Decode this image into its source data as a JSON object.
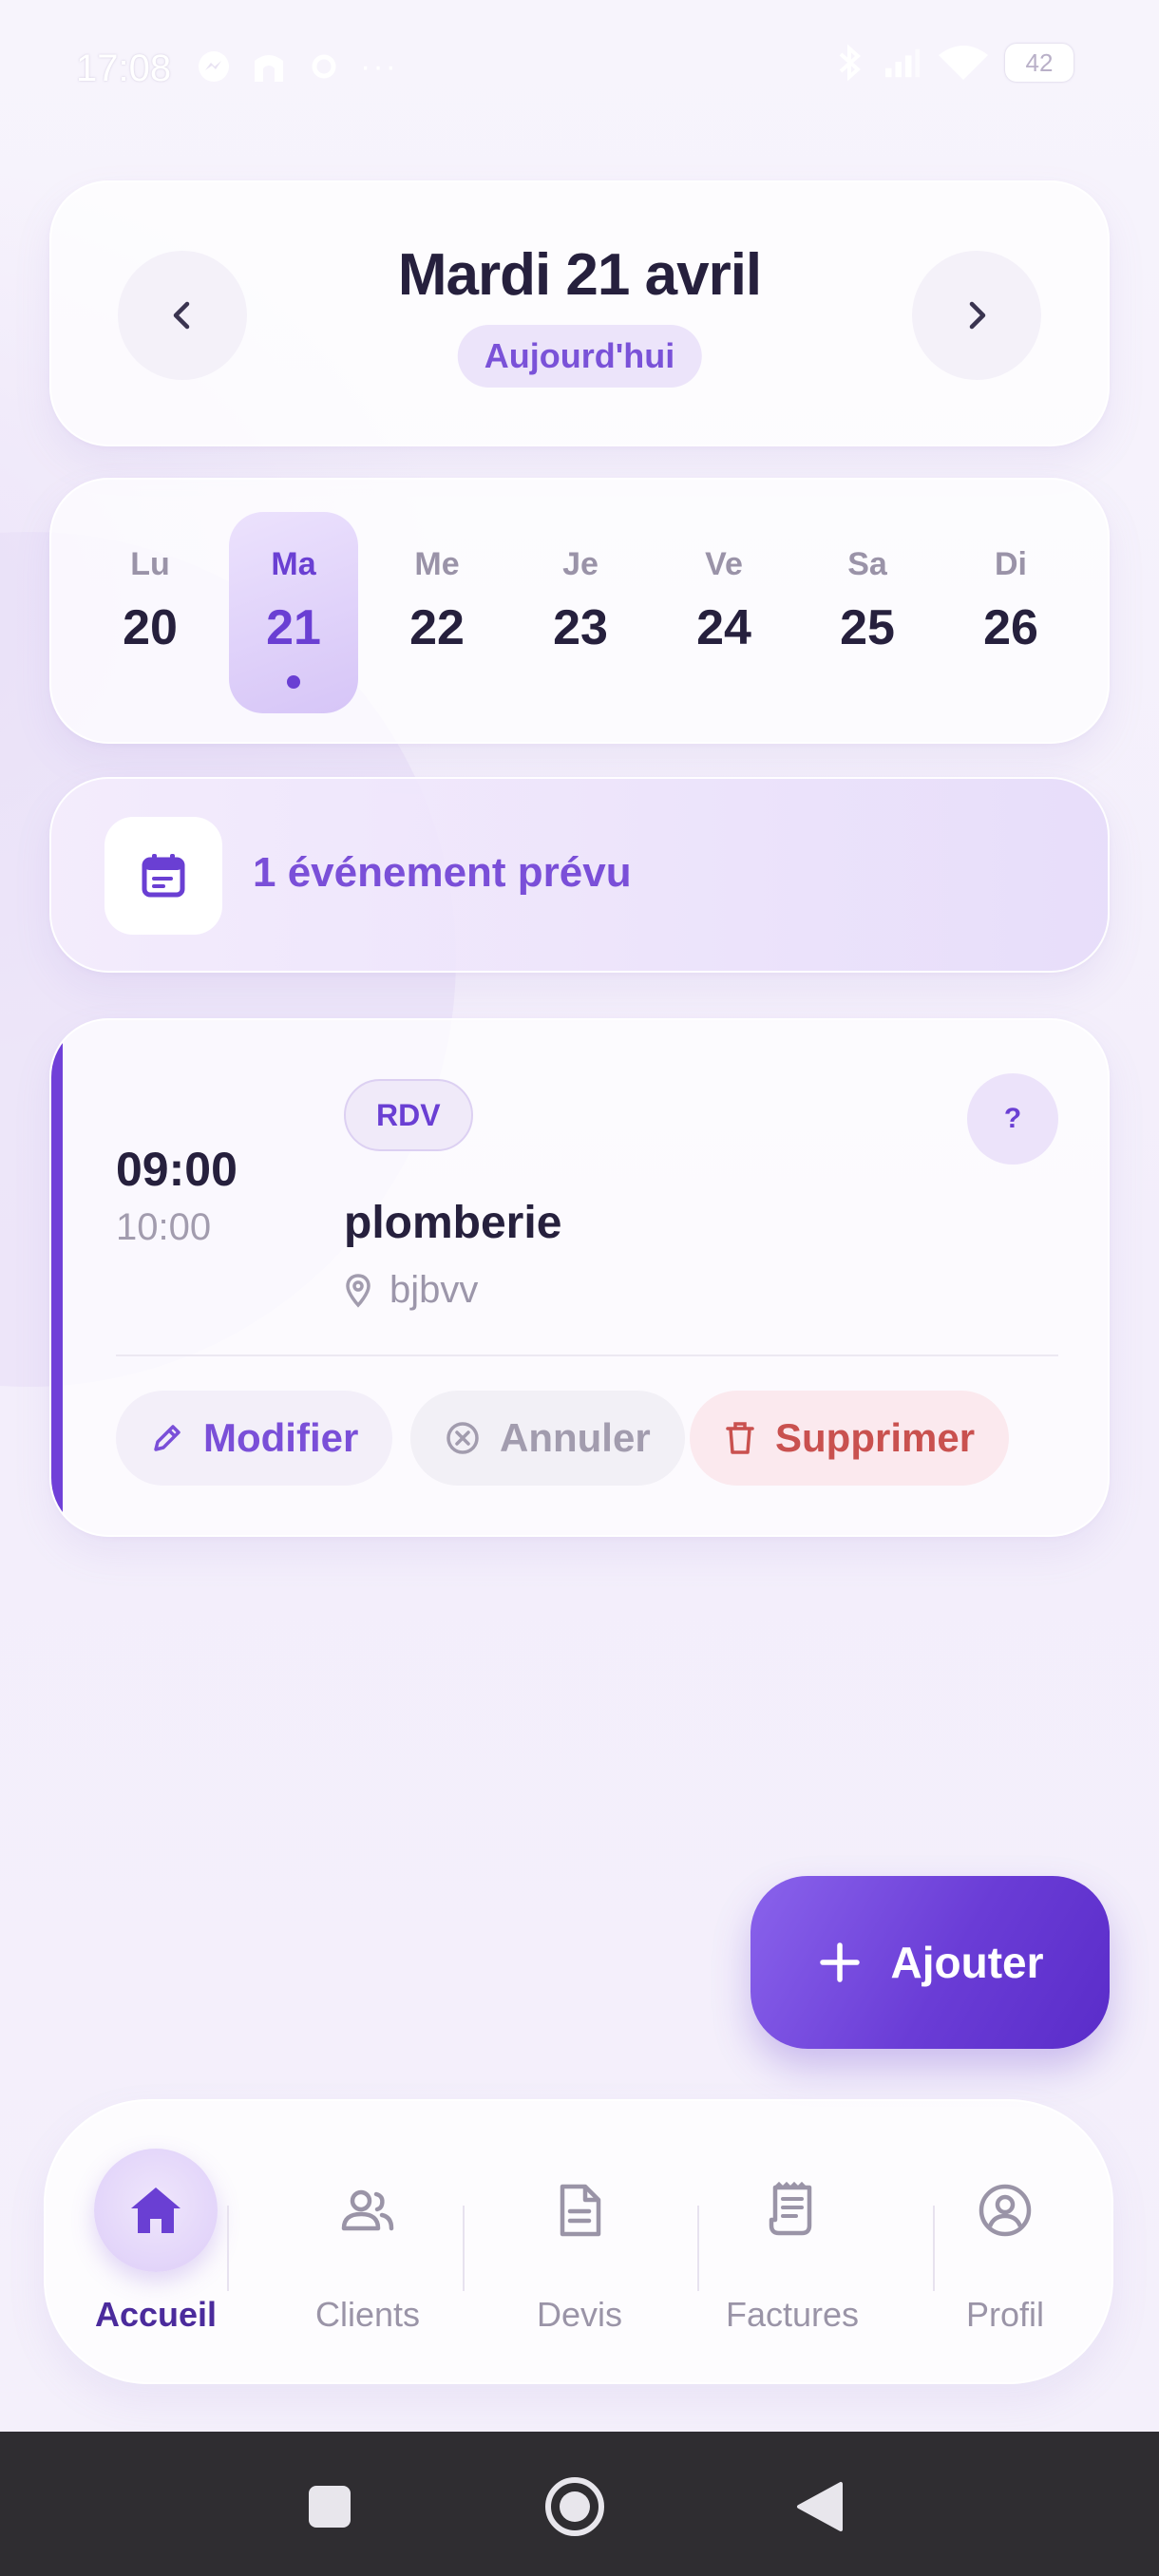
{
  "status_bar": {
    "time": "17:08",
    "notification_icons": [
      "messenger-icon",
      "home-app-icon",
      "settings-icon"
    ],
    "more_dots": "···",
    "system_icons": [
      "bluetooth-icon",
      "signal-icon",
      "wifi-icon"
    ],
    "battery": "42"
  },
  "header": {
    "date_title": "Mardi 21 avril",
    "today_label": "Aujourd'hui"
  },
  "week": {
    "days": [
      {
        "name": "Lu",
        "date": "20",
        "selected": false
      },
      {
        "name": "Ma",
        "date": "21",
        "selected": true,
        "has_event": true
      },
      {
        "name": "Me",
        "date": "22",
        "selected": false
      },
      {
        "name": "Je",
        "date": "23",
        "selected": false
      },
      {
        "name": "Ve",
        "date": "24",
        "selected": false
      },
      {
        "name": "Sa",
        "date": "25",
        "selected": false
      },
      {
        "name": "Di",
        "date": "26",
        "selected": false
      }
    ]
  },
  "summary": {
    "text": "1 événement prévu",
    "icon": "calendar-icon"
  },
  "event": {
    "start_time": "09:00",
    "end_time": "10:00",
    "tag": "RDV",
    "help_label": "?",
    "title": "plomberie",
    "location": "bjbvv",
    "actions": {
      "edit": "Modifier",
      "cancel": "Annuler",
      "delete": "Supprimer"
    },
    "accent_color": "#7040d8"
  },
  "fab": {
    "label": "Ajouter",
    "icon": "plus-icon"
  },
  "bottom_nav": {
    "items": [
      {
        "label": "Accueil",
        "icon": "home-icon",
        "active": true
      },
      {
        "label": "Clients",
        "icon": "users-icon",
        "active": false
      },
      {
        "label": "Devis",
        "icon": "document-icon",
        "active": false
      },
      {
        "label": "Factures",
        "icon": "receipt-icon",
        "active": false
      },
      {
        "label": "Profil",
        "icon": "profile-icon",
        "active": false
      }
    ]
  },
  "colors": {
    "accent": "#6a3fd3",
    "accent_light": "#ece4fa",
    "text_dark": "#26203d",
    "danger": "#c9514f"
  }
}
